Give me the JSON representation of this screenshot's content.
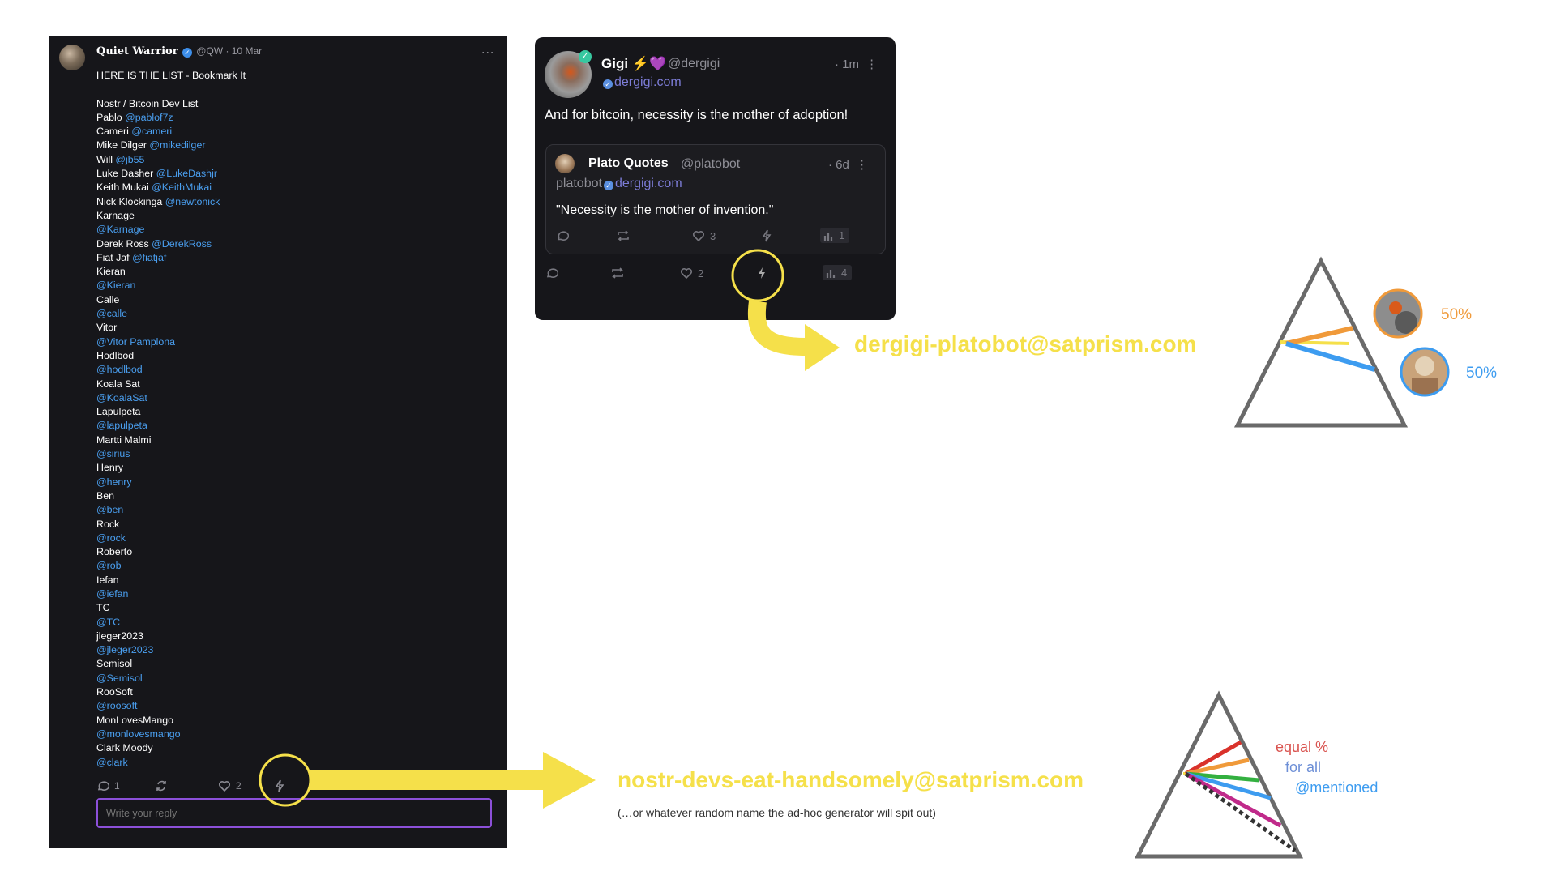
{
  "left_post": {
    "author_name": "Quiet Warrior",
    "handle": "@QW",
    "dot": "·",
    "date": "10 Mar",
    "more": "...",
    "lines": [
      [
        {
          "t": "HERE IS THE LIST - Bookmark It",
          "c": "w"
        }
      ],
      [],
      [
        {
          "t": "Nostr / Bitcoin Dev List",
          "c": "w"
        }
      ],
      [
        {
          "t": "Pablo ",
          "c": "w"
        },
        {
          "t": "@pablof7z",
          "c": "b"
        }
      ],
      [
        {
          "t": "Cameri ",
          "c": "w"
        },
        {
          "t": "@cameri",
          "c": "b"
        }
      ],
      [
        {
          "t": "Mike Dilger ",
          "c": "w"
        },
        {
          "t": "@mikedilger",
          "c": "b"
        }
      ],
      [
        {
          "t": "Will ",
          "c": "w"
        },
        {
          "t": "@jb55",
          "c": "b"
        }
      ],
      [
        {
          "t": "Luke Dasher ",
          "c": "w"
        },
        {
          "t": "@LukeDashjr",
          "c": "b"
        }
      ],
      [
        {
          "t": "Keith Mukai ",
          "c": "w"
        },
        {
          "t": "@KeithMukai",
          "c": "b"
        }
      ],
      [
        {
          "t": "Nick Klockinga ",
          "c": "w"
        },
        {
          "t": "@newtonick",
          "c": "b"
        }
      ],
      [
        {
          "t": "Karnage",
          "c": "w"
        }
      ],
      [
        {
          "t": "@Karnage",
          "c": "b"
        }
      ],
      [
        {
          "t": "Derek Ross ",
          "c": "w"
        },
        {
          "t": "@DerekRoss",
          "c": "b"
        }
      ],
      [
        {
          "t": "Fiat Jaf ",
          "c": "w"
        },
        {
          "t": "@fiatjaf",
          "c": "b"
        }
      ],
      [
        {
          "t": "Kieran",
          "c": "w"
        }
      ],
      [
        {
          "t": "@Kieran",
          "c": "b"
        }
      ],
      [
        {
          "t": "Calle",
          "c": "w"
        }
      ],
      [
        {
          "t": "@calle",
          "c": "b"
        }
      ],
      [
        {
          "t": "Vitor",
          "c": "w"
        }
      ],
      [
        {
          "t": "@Vitor Pamplona",
          "c": "b"
        }
      ],
      [
        {
          "t": "Hodlbod",
          "c": "w"
        }
      ],
      [
        {
          "t": "@hodlbod",
          "c": "b"
        }
      ],
      [
        {
          "t": "Koala Sat",
          "c": "w"
        }
      ],
      [
        {
          "t": "@KoalaSat",
          "c": "b"
        }
      ],
      [
        {
          "t": "Lapulpeta",
          "c": "w"
        }
      ],
      [
        {
          "t": "@lapulpeta",
          "c": "b"
        }
      ],
      [
        {
          "t": "Martti Malmi",
          "c": "w"
        }
      ],
      [
        {
          "t": "@sirius",
          "c": "b"
        }
      ],
      [
        {
          "t": "Henry",
          "c": "w"
        }
      ],
      [
        {
          "t": "@henry",
          "c": "b"
        }
      ],
      [
        {
          "t": "Ben",
          "c": "w"
        }
      ],
      [
        {
          "t": "@ben",
          "c": "b"
        }
      ],
      [
        {
          "t": "Rock",
          "c": "w"
        }
      ],
      [
        {
          "t": "@rock",
          "c": "b"
        }
      ],
      [
        {
          "t": "Roberto",
          "c": "w"
        }
      ],
      [
        {
          "t": "@rob",
          "c": "b"
        }
      ],
      [
        {
          "t": "Iefan",
          "c": "w"
        }
      ],
      [
        {
          "t": "@iefan",
          "c": "b"
        }
      ],
      [
        {
          "t": "TC",
          "c": "w"
        }
      ],
      [
        {
          "t": "@TC",
          "c": "b"
        }
      ],
      [
        {
          "t": "jleger2023",
          "c": "w"
        }
      ],
      [
        {
          "t": "@jleger2023",
          "c": "b"
        }
      ],
      [
        {
          "t": "Semisol",
          "c": "w"
        }
      ],
      [
        {
          "t": "@Semisol",
          "c": "b"
        }
      ],
      [
        {
          "t": "RooSoft",
          "c": "w"
        }
      ],
      [
        {
          "t": "@roosoft",
          "c": "b"
        }
      ],
      [
        {
          "t": "MonLovesMango",
          "c": "w"
        }
      ],
      [
        {
          "t": "@monlovesmango",
          "c": "b"
        }
      ],
      [
        {
          "t": "Clark Moody",
          "c": "w"
        }
      ],
      [
        {
          "t": "@clark",
          "c": "b"
        }
      ]
    ],
    "actions": {
      "reply_count": "1",
      "like_count": "2"
    },
    "reply_placeholder": "Write your reply"
  },
  "gigi_post": {
    "name": "Gigi ⚡💜",
    "handle": "@dergigi",
    "nip05": "dergigi.com",
    "time": "· 1m",
    "text": "And for bitcoin, necessity is the mother of adoption!",
    "actions": {
      "like_count": "2",
      "views": "4"
    },
    "quote": {
      "name": "Plato Quotes",
      "handle": "@platobot",
      "nip05_user": "platobot",
      "nip05_domain": "dergigi.com",
      "time": "· 6d",
      "text": "\"Necessity is the mother of invention.\"",
      "actions": {
        "like_count": "3",
        "views": "1"
      }
    }
  },
  "annotations": {
    "top_address": "dergigi-platobot@satprism.com",
    "top_split_1": "50%",
    "top_split_2": "50%",
    "bottom_address": "nostr-devs-eat-handsomely@satprism.com",
    "bottom_note": "(…or whatever random name the ad-hoc generator will spit out)",
    "equal_1": "equal %",
    "equal_2": "for all",
    "equal_3": "@mentioned"
  },
  "colors": {
    "panel_bg": "#16161a",
    "mention_blue": "#4a9ff0",
    "arrow_yellow": "#f5e04a",
    "reply_border": "#8c50d9",
    "split_orange": "#f09a3a",
    "split_blue": "#3d9cf0",
    "prism_gray": "#6a6a6a"
  },
  "icons": [
    "verified-badge-icon",
    "more-icon",
    "reply-icon",
    "repost-icon",
    "like-icon",
    "zap-icon",
    "views-icon",
    "prism-icon",
    "arrow-icon"
  ]
}
